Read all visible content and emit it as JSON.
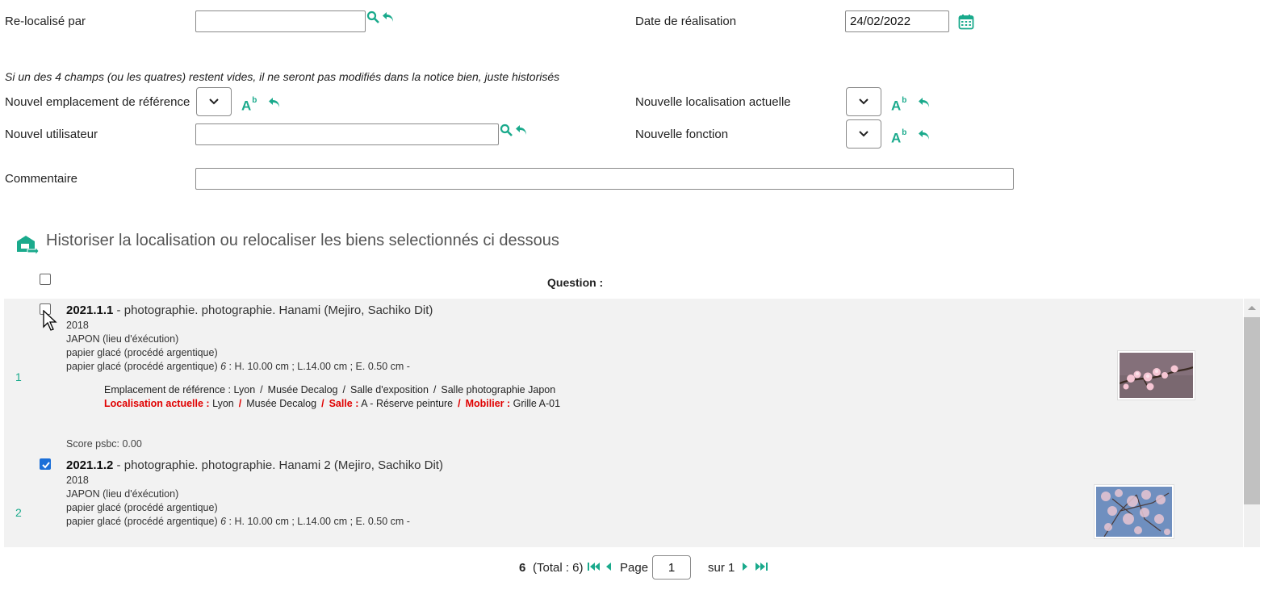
{
  "form": {
    "relocalise_label": "Re-localisé par",
    "relocalise_value": "",
    "date_label": "Date de réalisation",
    "date_value": "24/02/2022",
    "note": "Si un des 4 champs (ou les quatres) restent vides, il ne seront pas modifiés dans la notice bien, juste historisés",
    "emplacement_label": "Nouvel emplacement de référence",
    "localisation_label": "Nouvelle localisation actuelle",
    "utilisateur_label": "Nouvel utilisateur",
    "utilisateur_value": "",
    "fonction_label": "Nouvelle fonction",
    "commentaire_label": "Commentaire",
    "commentaire_value": "",
    "ab_text": "A",
    "ab_sup": "b"
  },
  "section": {
    "title": "Historiser la localisation ou relocaliser les biens selectionnés ci dessous",
    "column_header": "Question :"
  },
  "items": [
    {
      "number": "1",
      "checked": false,
      "code": "2021.1.1",
      "title": " - photographie. photographie. Hanami (Mejiro, Sachiko Dit)",
      "year": "2018",
      "place": "JAPON (lieu d'éxécution)",
      "material": "papier glacé (procédé argentique)",
      "dimensions_prefix": "papier glacé (procédé argentique) ",
      "dimensions_count": "6",
      "dimensions": " : H. 10.00 cm ; L.14.00 cm ; E. 0.50 cm -",
      "emplacement_label": "Emplacement de référence :",
      "emplacement_path": [
        "Lyon",
        "Musée Decalog",
        "Salle d'exposition",
        "Salle photographie Japon"
      ],
      "localisation_label": "Localisation actuelle :",
      "localisation_city": "Lyon",
      "localisation_museum": "Musée Decalog",
      "salle_label": "Salle :",
      "salle_value": "A - Réserve peinture",
      "mobilier_label": "Mobilier :",
      "mobilier_value": "Grille A-01",
      "score": "Score psbc: 0.00"
    },
    {
      "number": "2",
      "checked": true,
      "code": "2021.1.2",
      "title": " - photographie. photographie. Hanami 2 (Mejiro, Sachiko Dit)",
      "year": "2018",
      "place": "JAPON (lieu d'éxécution)",
      "material": "papier glacé (procédé argentique)",
      "dimensions_prefix": "papier glacé (procédé argentique) ",
      "dimensions_count": "6",
      "dimensions": " : H. 10.00 cm ; L.14.00 cm ; E. 0.50 cm -"
    }
  ],
  "pager": {
    "count": "6",
    "total": "(Total : 6)",
    "page_label": "Page",
    "page_value": "1",
    "of_label": "sur 1"
  },
  "colors": {
    "accent": "#1aaa8c",
    "red": "#e00000",
    "checkbox_blue": "#1b6fd8"
  }
}
